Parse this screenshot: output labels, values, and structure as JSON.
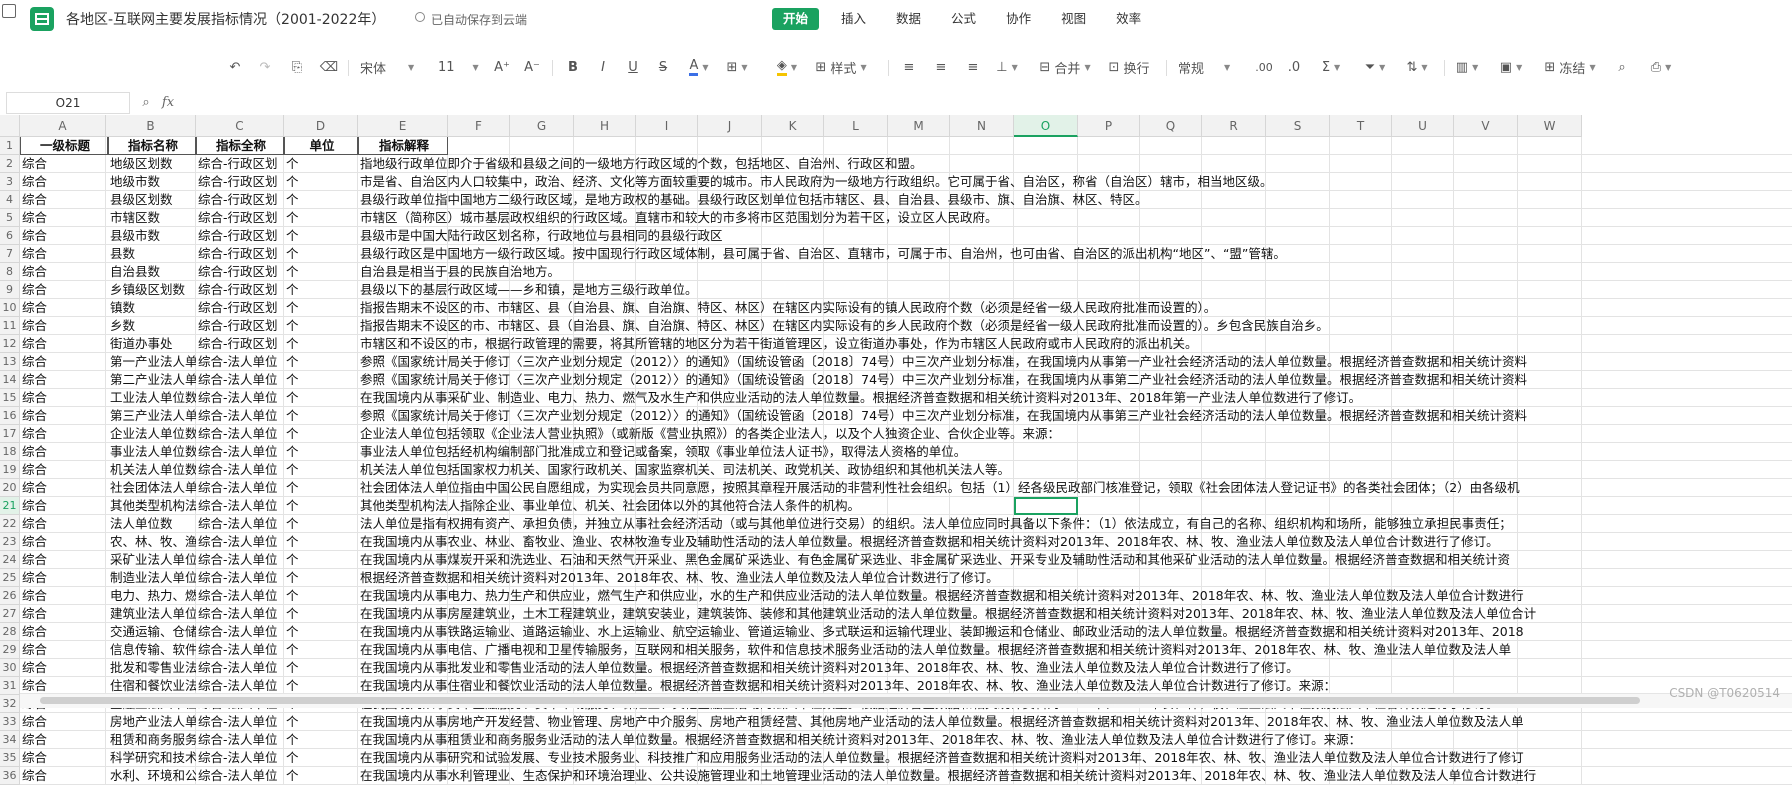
{
  "header": {
    "title": "各地区-互联网主要发展指标情况（2001-2022年）",
    "save_status": "已自动保存到云端",
    "tabs": [
      "开始",
      "插入",
      "数据",
      "公式",
      "协作",
      "视图",
      "效率"
    ],
    "active_tab": "开始"
  },
  "toolbar": {
    "font_name": "宋体",
    "font_size": "11",
    "style_label": "样式",
    "merge_label": "合并",
    "wrap_label": "换行",
    "number_format": "常规",
    "freeze_label": "冻结",
    "accent_color": "#1aa260"
  },
  "formula_bar": {
    "cell_ref": "O21",
    "fx_symbol": "fx",
    "formula": ""
  },
  "columns": [
    "A",
    "B",
    "C",
    "D",
    "E",
    "F",
    "G",
    "H",
    "I",
    "J",
    "K",
    "L",
    "M",
    "N",
    "O",
    "P",
    "Q",
    "R",
    "S",
    "T",
    "U",
    "V",
    "W"
  ],
  "selected_column": "O",
  "selected_row": "21",
  "header_row": [
    "一级标题",
    "指标名称",
    "指标全称",
    "单位",
    "指标解释"
  ],
  "rows": [
    {
      "n": "2",
      "a": "综合",
      "b": "地级区划数",
      "c": "综合-行政区划",
      "d": "个",
      "e": "指地级行政单位即介于省级和县级之间的一级地方行政区域的个数，包括地区、自治州、行政区和盟。"
    },
    {
      "n": "3",
      "a": "综合",
      "b": "地级市数",
      "c": "综合-行政区划",
      "d": "个",
      "e": "市是省、自治区内人口较集中，政治、经济、文化等方面较重要的城市。市人民政府为一级地方行政组织。它可属于省、自治区，称省（自治区）辖市，相当地区级。"
    },
    {
      "n": "4",
      "a": "综合",
      "b": "县级区划数",
      "c": "综合-行政区划",
      "d": "个",
      "e": "县级行政单位指中国地方二级行政区域，是地方政权的基础。县级行政区划单位包括市辖区、县、自治县、县级市、旗、自治旗、林区、特区。"
    },
    {
      "n": "5",
      "a": "综合",
      "b": "市辖区数",
      "c": "综合-行政区划",
      "d": "个",
      "e": "市辖区（简称区）城市基层政权组织的行政区域。直辖市和较大的市多将市区范围划分为若干区，设立区人民政府。"
    },
    {
      "n": "6",
      "a": "综合",
      "b": "县级市数",
      "c": "综合-行政区划",
      "d": "个",
      "e": "县级市是中国大陆行政区划名称，行政地位与县相同的县级行政区"
    },
    {
      "n": "7",
      "a": "综合",
      "b": "县数",
      "c": "综合-行政区划",
      "d": "个",
      "e": "县级行政区是中国地方一级行政区域。按中国现行行政区域体制，县可属于省、自治区、直辖市，可属于市、自治州，也可由省、自治区的派出机构“地区”、“盟”管辖。"
    },
    {
      "n": "8",
      "a": "综合",
      "b": "自治县数",
      "c": "综合-行政区划",
      "d": "个",
      "e": "自治县是相当于县的民族自治地方。"
    },
    {
      "n": "9",
      "a": "综合",
      "b": "乡镇级区划数",
      "c": "综合-行政区划",
      "d": "个",
      "e": "县级以下的基层行政区域——乡和镇，是地方三级行政单位。"
    },
    {
      "n": "10",
      "a": "综合",
      "b": "镇数",
      "c": "综合-行政区划",
      "d": "个",
      "e": "指报告期末不设区的市、市辖区、县（自治县、旗、自治旗、特区、林区）在辖区内实际设有的镇人民政府个数（必须是经省一级人民政府批准而设置的）。"
    },
    {
      "n": "11",
      "a": "综合",
      "b": "乡数",
      "c": "综合-行政区划",
      "d": "个",
      "e": "指报告期末不设区的市、市辖区、县（自治县、旗、自治旗、特区、林区）在辖区内实际设有的乡人民政府个数（必须是经省一级人民政府批准而设置的）。乡包含民族自治乡。"
    },
    {
      "n": "12",
      "a": "综合",
      "b": "街道办事处",
      "c": "综合-行政区划",
      "d": "个",
      "e": "市辖区和不设区的市，根据行政管理的需要，将其所管辖的地区分为若干街道管理区，设立街道办事处，作为市辖区人民政府或市人民政府的派出机关。"
    },
    {
      "n": "13",
      "a": "综合",
      "b": "第一产业法人单",
      "c": "综合-法人单位",
      "d": "个",
      "e": "参照《国家统计局关于修订〈三次产业划分规定（2012）〉的通知》（国统设管函〔2018〕74号）中三次产业划分标准，在我国境内从事第一产业社会经济活动的法人单位数量。根据经济普查数据和相关统计资料"
    },
    {
      "n": "14",
      "a": "综合",
      "b": "第二产业法人单",
      "c": "综合-法人单位",
      "d": "个",
      "e": "参照《国家统计局关于修订〈三次产业划分规定（2012）〉的通知》（国统设管函〔2018〕74号）中三次产业划分标准，在我国境内从事第二产业社会经济活动的法人单位数量。根据经济普查数据和相关统计资料"
    },
    {
      "n": "15",
      "a": "综合",
      "b": "工业法人单位数",
      "c": "综合-法人单位",
      "d": "个",
      "e": "在我国境内从事采矿业、制造业、电力、热力、燃气及水生产和供应业活动的法人单位数量。根据经济普查数据和相关统计资料对2013年、2018年第一产业法人单位数进行了修订。"
    },
    {
      "n": "16",
      "a": "综合",
      "b": "第三产业法人单",
      "c": "综合-法人单位",
      "d": "个",
      "e": "参照《国家统计局关于修订〈三次产业划分规定（2012）〉的通知》（国统设管函〔2018〕74号）中三次产业划分标准，在我国境内从事第三产业社会经济活动的法人单位数量。根据经济普查数据和相关统计资料"
    },
    {
      "n": "17",
      "a": "综合",
      "b": "企业法人单位数",
      "c": "综合-法人单位",
      "d": "个",
      "e": "企业法人单位包括领取《企业法人营业执照》（或新版《营业执照》）的各类企业法人，以及个人独资企业、合伙企业等。来源："
    },
    {
      "n": "18",
      "a": "综合",
      "b": "事业法人单位数",
      "c": "综合-法人单位",
      "d": "个",
      "e": "事业法人单位包括经机构编制部门批准成立和登记或备案，领取《事业单位法人证书》，取得法人资格的单位。"
    },
    {
      "n": "19",
      "a": "综合",
      "b": "机关法人单位数",
      "c": "综合-法人单位",
      "d": "个",
      "e": "机关法人单位包括国家权力机关、国家行政机关、国家监察机关、司法机关、政党机关、政协组织和其他机关法人等。"
    },
    {
      "n": "20",
      "a": "综合",
      "b": "社会团体法人单",
      "c": "综合-法人单位",
      "d": "个",
      "e": "社会团体法人单位指由中国公民自愿组成，为实现会员共同意愿，按照其章程开展活动的非营利性社会组织。包括（1）经各级民政部门核准登记，领取《社会团体法人登记证书》的各类社会团体；（2）由各级机"
    },
    {
      "n": "21",
      "a": "综合",
      "b": "其他类型机构法",
      "c": "综合-法人单位",
      "d": "个",
      "e": "其他类型机构法人指除企业、事业单位、机关、社会团体以外的其他符合法人条件的机构。"
    },
    {
      "n": "22",
      "a": "综合",
      "b": "法人单位数",
      "c": "综合-法人单位",
      "d": "个",
      "e": "法人单位是指有权拥有资产、承担负债，并独立从事社会经济活动（或与其他单位进行交易）的组织。法人单位应同时具备以下条件：（1）依法成立，有自己的名称、组织机构和场所，能够独立承担民事责任；"
    },
    {
      "n": "23",
      "a": "综合",
      "b": "农、林、牧、渔",
      "c": "综合-法人单位",
      "d": "个",
      "e": "在我国境内从事农业、林业、畜牧业、渔业、农林牧渔专业及辅助性活动的法人单位数量。根据经济普查数据和相关统计资料对2013年、2018年农、林、牧、渔业法人单位数及法人单位合计数进行了修订。"
    },
    {
      "n": "24",
      "a": "综合",
      "b": "采矿业法人单位",
      "c": "综合-法人单位",
      "d": "个",
      "e": "在我国境内从事煤炭开采和洗选业、石油和天然气开采业、黑色金属矿采选业、有色金属矿采选业、非金属矿采选业、开采专业及辅助性活动和其他采矿业活动的法人单位数量。根据经济普查数据和相关统计资"
    },
    {
      "n": "25",
      "a": "综合",
      "b": "制造业法人单位",
      "c": "综合-法人单位",
      "d": "个",
      "e": "根据经济普查数据和相关统计资料对2013年、2018年农、林、牧、渔业法人单位数及法人单位合计数进行了修订。"
    },
    {
      "n": "26",
      "a": "综合",
      "b": "电力、热力、燃",
      "c": "综合-法人单位",
      "d": "个",
      "e": "在我国境内从事电力、热力生产和供应业，燃气生产和供应业，水的生产和供应业活动的法人单位数量。根据经济普查数据和相关统计资料对2013年、2018年农、林、牧、渔业法人单位数及法人单位合计数进行"
    },
    {
      "n": "27",
      "a": "综合",
      "b": "建筑业法人单位",
      "c": "综合-法人单位",
      "d": "个",
      "e": "在我国境内从事房屋建筑业，土木工程建筑业，建筑安装业，建筑装饰、装修和其他建筑业活动的法人单位数量。根据经济普查数据和相关统计资料对2013年、2018年农、林、牧、渔业法人单位数及法人单位合计"
    },
    {
      "n": "28",
      "a": "综合",
      "b": "交通运输、仓储",
      "c": "综合-法人单位",
      "d": "个",
      "e": "在我国境内从事铁路运输业、道路运输业、水上运输业、航空运输业、管道运输业、多式联运和运输代理业、装卸搬运和仓储业、邮政业活动的法人单位数量。根据经济普查数据和相关统计资料对2013年、2018"
    },
    {
      "n": "29",
      "a": "综合",
      "b": "信息传输、软件",
      "c": "综合-法人单位",
      "d": "个",
      "e": "在我国境内从事电信、广播电视和卫星传输服务，互联网和相关服务，软件和信息技术服务业活动的法人单位数量。根据经济普查数据和相关统计资料对2013年、2018年农、林、牧、渔业法人单位数及法人单"
    },
    {
      "n": "30",
      "a": "综合",
      "b": "批发和零售业法",
      "c": "综合-法人单位",
      "d": "个",
      "e": "在我国境内从事批发业和零售业活动的法人单位数量。根据经济普查数据和相关统计资料对2013年、2018年农、林、牧、渔业法人单位数及法人单位合计数进行了修订。"
    },
    {
      "n": "31",
      "a": "综合",
      "b": "住宿和餐饮业法",
      "c": "综合-法人单位",
      "d": "个",
      "e": "在我国境内从事住宿业和餐饮业活动的法人单位数量。根据经济普查数据和相关统计资料对2013年、2018年农、林、牧、渔业法人单位数及法人单位合计数进行了修订。来源："
    },
    {
      "n": "32",
      "a": "综合",
      "b": "金融业法人单位",
      "c": "综合-法人单位",
      "d": "个",
      "e": "在我国境内从事货币金融服务、资本市场服务、保险业、其他金融业活动的法人单位数量。根据经济普查数据和相关统计资料对2013年、2018年农、林、牧、渔业法人单位数及法人单位合计数进行了修订。"
    },
    {
      "n": "33",
      "a": "综合",
      "b": "房地产业法人单",
      "c": "综合-法人单位",
      "d": "个",
      "e": "在我国境内从事房地产开发经营、物业管理、房地产中介服务、房地产租赁经营、其他房地产业活动的法人单位数量。根据经济普查数据和相关统计资料对2013年、2018年农、林、牧、渔业法人单位数及法人单"
    },
    {
      "n": "34",
      "a": "综合",
      "b": "租赁和商务服务",
      "c": "综合-法人单位",
      "d": "个",
      "e": "在我国境内从事租赁业和商务服务业活动的法人单位数量。根据经济普查数据和相关统计资料对2013年、2018年农、林、牧、渔业法人单位数及法人单位合计数进行了修订。来源："
    },
    {
      "n": "35",
      "a": "综合",
      "b": "科学研究和技术",
      "c": "综合-法人单位",
      "d": "个",
      "e": "在我国境内从事研究和试验发展、专业技术服务业、科技推广和应用服务业活动的法人单位数量。根据经济普查数据和相关统计资料对2013年、2018年农、林、牧、渔业法人单位数及法人单位合计数进行了修订"
    },
    {
      "n": "36",
      "a": "综合",
      "b": "水利、环境和公",
      "c": "综合-法人单位",
      "d": "个",
      "e": "在我国境内从事水利管理业、生态保护和环境治理业、公共设施管理业和土地管理业活动的法人单位数量。根据经济普查数据和相关统计资料对2013年、2018年农、林、牧、渔业法人单位数及法人单位合计数进行"
    }
  ],
  "watermark": "CSDN @T0620514"
}
